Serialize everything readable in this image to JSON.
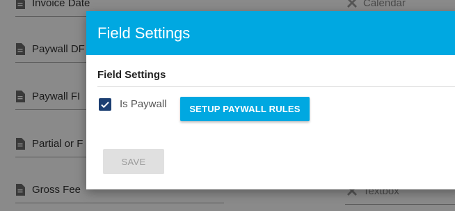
{
  "background": {
    "fields": [
      {
        "label": "Invoice Date",
        "icon": "document-icon"
      },
      {
        "label": "Paywall DF",
        "icon": "document-icon"
      },
      {
        "label": "Paywall FI",
        "icon": "document-icon"
      },
      {
        "label": "Partial or F",
        "icon": "document-icon"
      },
      {
        "label": "Gross Fee",
        "icon": "document-icon"
      }
    ],
    "field_types": [
      {
        "label": "Calendar",
        "icon": "tools-icon"
      },
      {
        "label": "Textbox",
        "icon": "tools-icon"
      }
    ]
  },
  "modal": {
    "title": "Field Settings",
    "section_title": "Field Settings",
    "is_paywall": {
      "label": "Is Paywall",
      "checked": true
    },
    "setup_button": "SETUP PAYWALL RULES",
    "save_button": "SAVE",
    "accent_color": "#00a8e1",
    "checkbox_color": "#1c3f72"
  }
}
